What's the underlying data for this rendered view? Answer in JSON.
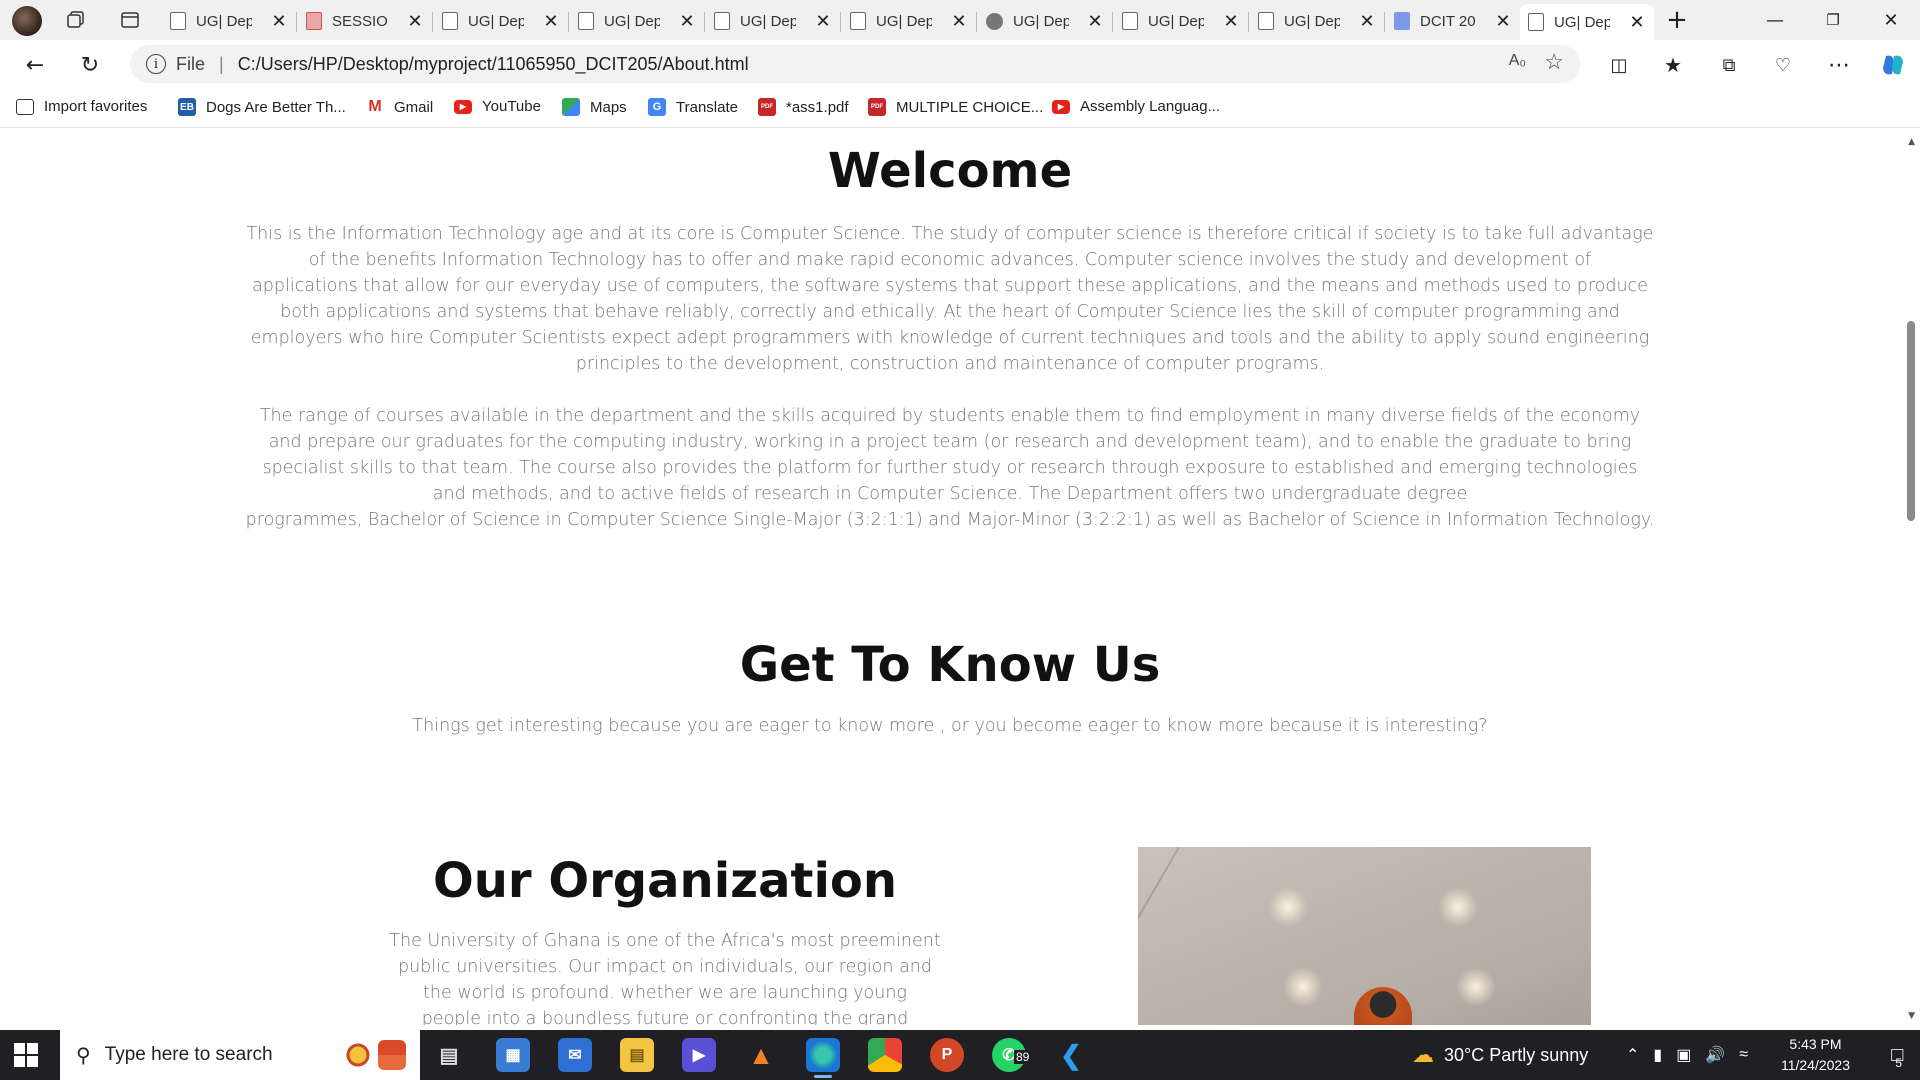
{
  "browser": {
    "tabs": [
      {
        "label": "UG| Dep",
        "icon": "doc"
      },
      {
        "label": "SESSION",
        "icon": "pdf"
      },
      {
        "label": "UG| Dep",
        "icon": "doc"
      },
      {
        "label": "UG| Dep",
        "icon": "doc"
      },
      {
        "label": "UG| Dep",
        "icon": "doc"
      },
      {
        "label": "UG| Dep",
        "icon": "doc"
      },
      {
        "label": "UG| Dep",
        "icon": "gray"
      },
      {
        "label": "UG| Dep",
        "icon": "doc"
      },
      {
        "label": "UG| Dep",
        "icon": "doc"
      },
      {
        "label": "DCIT 20",
        "icon": "gdoc"
      },
      {
        "label": "UG| Dep",
        "icon": "doc",
        "active": true
      }
    ],
    "address": {
      "scheme": "File",
      "url": "C:/Users/HP/Desktop/myproject/11065950_DCIT205/About.html"
    },
    "favorites": [
      {
        "label": "Import favorites",
        "icon": "import-icon"
      },
      {
        "label": "Dogs Are Better Th...",
        "icon": "eb-icon",
        "badge": "EB"
      },
      {
        "label": "Gmail",
        "icon": "gmail-icon",
        "badge": "M"
      },
      {
        "label": "YouTube",
        "icon": "youtube-icon"
      },
      {
        "label": "Maps",
        "icon": "maps-icon"
      },
      {
        "label": "Translate",
        "icon": "translate-icon"
      },
      {
        "label": "*ass1.pdf",
        "icon": "pdf-icon",
        "badge": "PDF"
      },
      {
        "label": "MULTIPLE CHOICE...",
        "icon": "pdf-icon",
        "badge": "PDF"
      },
      {
        "label": "Assembly Languag...",
        "icon": "youtube-icon"
      }
    ]
  },
  "page": {
    "welcome": {
      "title": "Welcome",
      "p1": [
        "This is the Information Technology age and at its core is Computer Science. The study of computer science is therefore critical if society is to take full advantage",
        "of the benefits Information Technology has to offer and make rapid economic advances. Computer science involves the study and development of",
        "applications that allow for our everyday use of computers, the software systems that support these applications, and the means and methods used to produce",
        "both applications and systems that behave reliably, correctly and ethically. At the heart of Computer Science lies the skill of computer programming and",
        "employers who hire Computer Scientists expect adept programmers with knowledge of current techniques and tools and the ability to apply sound engineering",
        "principles to the development, construction and maintenance of computer programs."
      ],
      "p2": [
        "The range of courses available in the department and the skills acquired by students enable them to find employment in many diverse fields of the economy",
        "and prepare our graduates for the computing industry, working in a project team (or research and development team), and to enable the graduate to bring",
        "specialist skills to that team. The course also provides the platform for further study or research through exposure to established and emerging technologies",
        "and methods, and to active fields of research in Computer Science. The Department offers two undergraduate degree",
        "programmes, Bachelor of Science in Computer Science Single-Major (3:2:1:1) and Major-Minor (3:2:2:1) as well as Bachelor of Science in Information Technology."
      ]
    },
    "know_us": {
      "title": "Get To Know Us",
      "text": "Things get interesting because you are eager to know more , or you become eager to know more because it is interesting?"
    },
    "organization": {
      "title": "Our Organization",
      "lines": [
        "The University of Ghana is one of the Africa's most preeminent",
        "public universities. Our impact on individuals, our region and",
        "the world is profound. whether we are launching young",
        "people into a boundless future or confronting the grand"
      ]
    }
  },
  "taskbar": {
    "search_placeholder": "Type here to search",
    "whatsapp_badge": "89",
    "weather": "30°C  Partly sunny",
    "time": "5:43 PM",
    "date": "11/24/2023",
    "notification_count": "5"
  }
}
